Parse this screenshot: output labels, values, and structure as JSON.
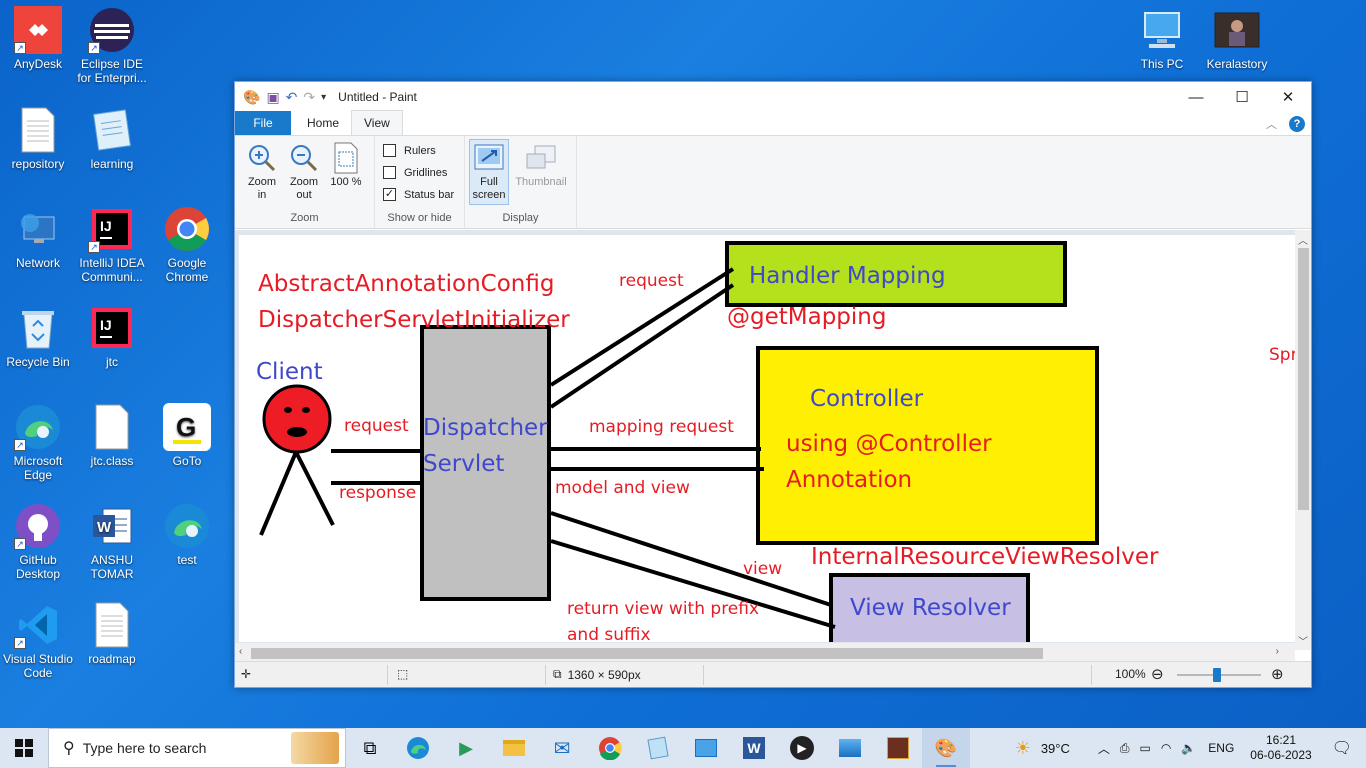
{
  "desktop": {
    "icons": [
      {
        "label": "AnyDesk"
      },
      {
        "label": "Eclipse IDE for Enterpri..."
      },
      {
        "label": "repository"
      },
      {
        "label": "learning"
      },
      {
        "label": "Network"
      },
      {
        "label": "IntelliJ IDEA Communi..."
      },
      {
        "label": "Google Chrome"
      },
      {
        "label": "Recycle Bin"
      },
      {
        "label": "jtc"
      },
      {
        "label": "Microsoft Edge"
      },
      {
        "label": "jtc.class"
      },
      {
        "label": "GoTo"
      },
      {
        "label": "GitHub Desktop"
      },
      {
        "label": "ANSHU TOMAR"
      },
      {
        "label": "test"
      },
      {
        "label": "Visual Studio Code"
      },
      {
        "label": "roadmap"
      },
      {
        "label": "This PC"
      },
      {
        "label": "Keralastory"
      }
    ]
  },
  "paint": {
    "title": "Untitled - Paint",
    "tabs": {
      "file": "File",
      "home": "Home",
      "view": "View"
    },
    "ribbon": {
      "zoom_in": "Zoom in",
      "zoom_out": "Zoom out",
      "hundred": "100 %",
      "zoom_group": "Zoom",
      "rulers": "Rulers",
      "gridlines": "Gridlines",
      "status_bar": "Status bar",
      "show_hide_group": "Show or hide",
      "full_screen": "Full screen",
      "thumbnail": "Thumbnail",
      "display_group": "Display"
    },
    "checks": {
      "rulers": false,
      "gridlines": false,
      "status_bar": true
    },
    "status": {
      "size": "1360 × 590px",
      "zoom": "100%"
    },
    "drawing": {
      "title_line1": "AbstractAnnotationConfig",
      "title_line2": "DispatcherServletInitializer",
      "client": "Client",
      "request": "request",
      "response": "response",
      "dispatcher_line1": "Dispatcher",
      "dispatcher_line2": "Servlet",
      "request_top": "request",
      "handler_mapping": "Handler Mapping",
      "get_mapping": "@getMapping",
      "spr": "Spr",
      "mapping_request": "mapping request",
      "model_and_view": "model and view",
      "controller": "Controller",
      "using_controller": "using @Controller",
      "annotation": "Annotation",
      "internal_resolver": "InternalResourceViewResolver",
      "view": "view",
      "view_resolver": "View Resolver",
      "return_line1": "return view with prefix",
      "return_line2": "and suffix"
    }
  },
  "taskbar": {
    "search_placeholder": "Type here to search",
    "weather": "39°C",
    "lang": "ENG",
    "time": "16:21",
    "date": "06-06-2023"
  }
}
